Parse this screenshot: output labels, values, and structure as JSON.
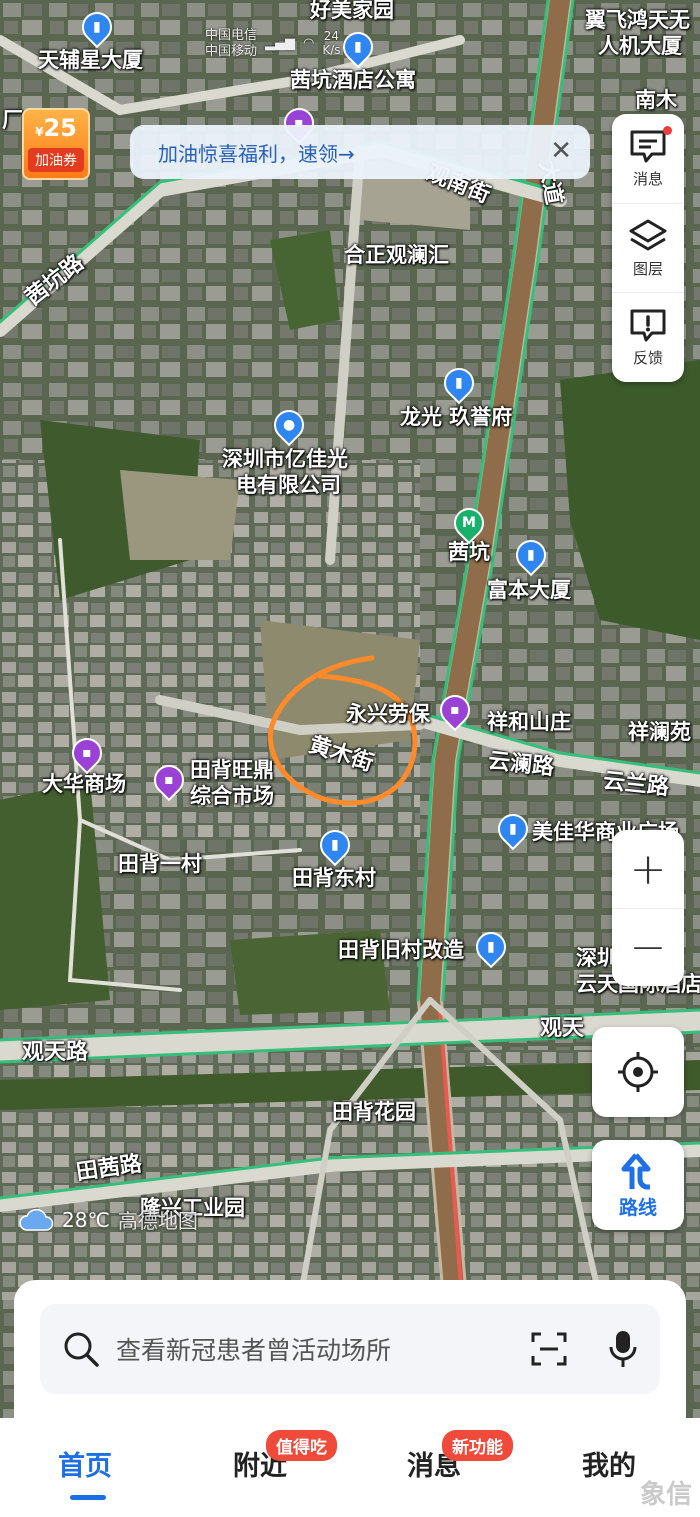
{
  "status": {
    "carrier_1": "中国电信",
    "carrier_2": "中国移动",
    "speed_value": "24",
    "speed_unit": "K/s"
  },
  "coupon": {
    "currency": "¥",
    "amount": "25",
    "label": "加油券"
  },
  "banner": {
    "text": "加油惊喜福利，速领→",
    "close": "✕"
  },
  "toolbar": {
    "messages": "消息",
    "layers": "图层",
    "feedback": "反馈"
  },
  "map": {
    "labels": {
      "haomei": "好美家园",
      "tianfu": "天辅星大厦",
      "qiankeng_hotel": "茜坑酒店公寓",
      "yifei": "翼飞鸿天无",
      "yifei2": "人机大厦",
      "nanmu": "南木",
      "chang": "厂",
      "guannan": "观南街",
      "dadao": "大道",
      "qiankeng_rd": "茜坑路",
      "hezheng": "合正观澜汇",
      "longguang": "龙光 玖誉府",
      "yijiaguang1": "深圳市亿佳光",
      "yijiaguang2": "电有限公司",
      "qiankeng_metro": "茜坑",
      "fuben": "富本大厦",
      "yongxing": "永兴劳保",
      "huangmu": "黄木街",
      "xianghe": "祥和山庄",
      "xianglan": "祥澜苑",
      "yunlan": "云澜路",
      "yunlan2": "云兰路",
      "dahua": "大华商场",
      "tianbei_market1": "田背旺鼎",
      "tianbei_market2": "综合市场",
      "meijiahua": "美佳华商业广场",
      "tianbei1": "田背一村",
      "tianbei_east": "田背东村",
      "tianbei_old": "田背旧村改造",
      "shenzhen_hotel1": "深圳观澜",
      "shenzhen_hotel2": "云天国际酒店",
      "guantian": "观天路",
      "guantian2": "观天",
      "tianbei_garden": "田背花园",
      "tianqian": "田茜路",
      "longxing": "隆兴工业园"
    }
  },
  "weather": {
    "temp": "28℃",
    "brand": "高德地图"
  },
  "controls": {
    "zoom_in": "+",
    "zoom_out": "−",
    "route": "路线"
  },
  "search": {
    "placeholder": "查看新冠患者曾活动场所"
  },
  "tabs": {
    "home": "首页",
    "nearby": "附近",
    "nearby_badge": "值得吃",
    "messages": "消息",
    "messages_badge": "新功能",
    "me": "我的"
  },
  "watermark": "象信"
}
